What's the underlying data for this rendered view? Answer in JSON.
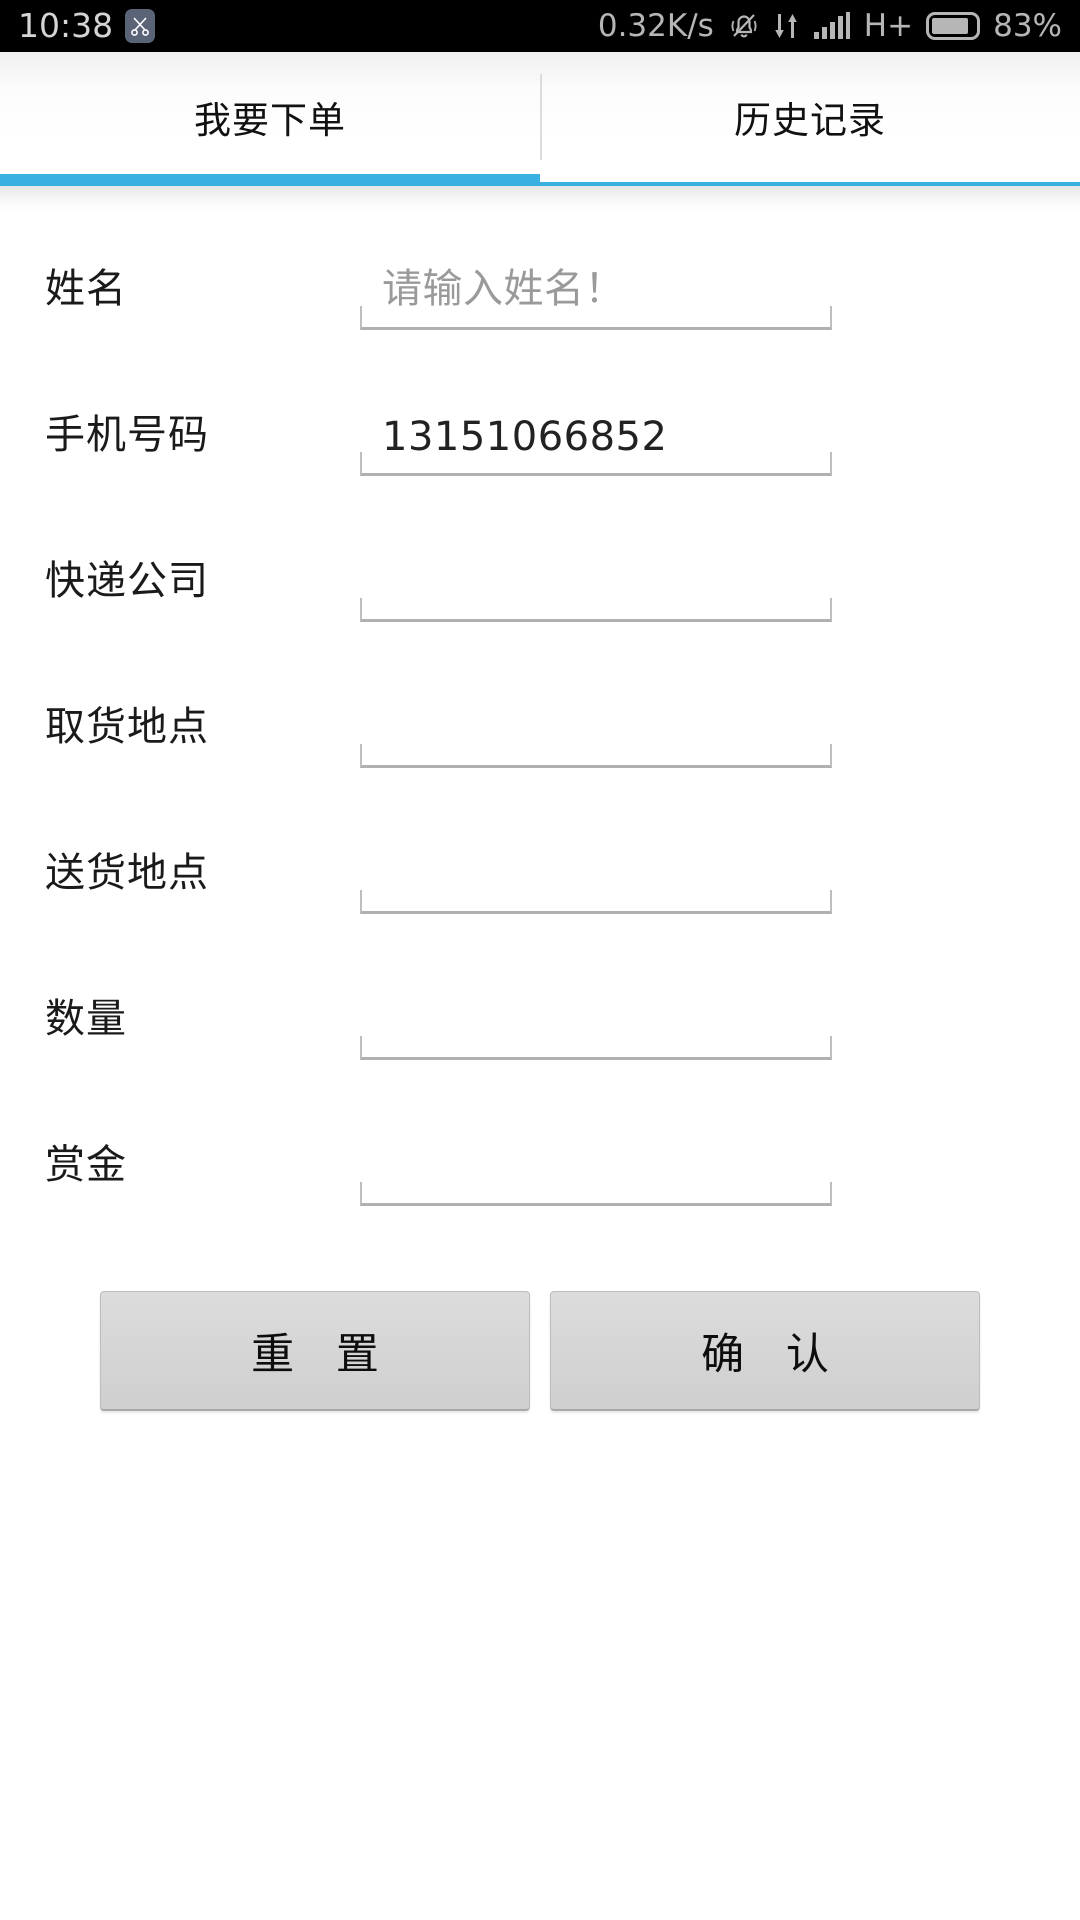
{
  "status_bar": {
    "time": "10:38",
    "screenshot_badge_icon": "scissors-icon",
    "network_speed": "0.32K/s",
    "mute_icon": "bell-muted-icon",
    "data_transfer_icon": "data-transfer-arrows-icon",
    "signal_icon": "signal-bars-icon",
    "network_type": "H+",
    "battery_icon": "battery-icon",
    "battery_percent": "83%",
    "background_color": "#000000",
    "text_color": "#b6b6b6"
  },
  "tabs": {
    "active_index": 0,
    "indicator_color": "#39b0e2",
    "items": [
      {
        "label": "我要下单"
      },
      {
        "label": "历史记录"
      }
    ]
  },
  "form": {
    "fields": [
      {
        "label": "姓名",
        "value": "",
        "placeholder": "请输入姓名！",
        "is_placeholder": true
      },
      {
        "label": "手机号码",
        "value": "13151066852",
        "placeholder": "",
        "is_placeholder": false
      },
      {
        "label": "快递公司",
        "value": "",
        "placeholder": "",
        "is_placeholder": false
      },
      {
        "label": "取货地点",
        "value": "",
        "placeholder": "",
        "is_placeholder": false
      },
      {
        "label": "送货地点",
        "value": "",
        "placeholder": "",
        "is_placeholder": false
      },
      {
        "label": "数量",
        "value": "",
        "placeholder": "",
        "is_placeholder": false
      },
      {
        "label": "赏金",
        "value": "",
        "placeholder": "",
        "is_placeholder": false
      }
    ]
  },
  "buttons": {
    "reset_label": "重 置",
    "confirm_label": "确 认"
  }
}
